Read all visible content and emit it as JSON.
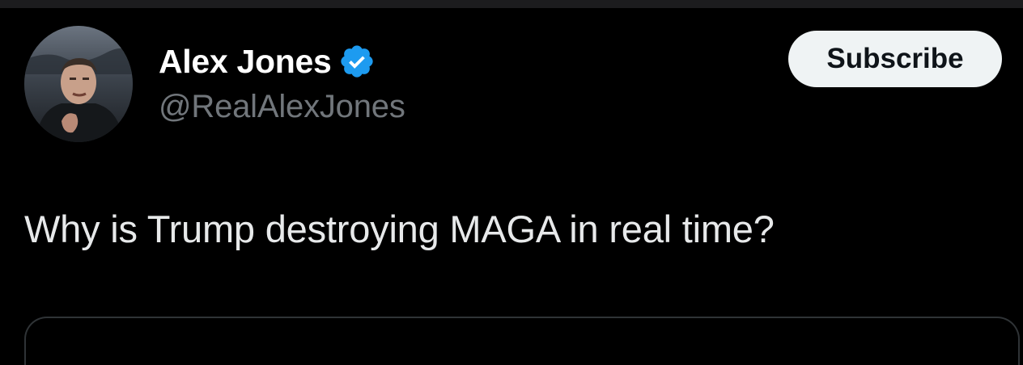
{
  "author": {
    "display_name": "Alex Jones",
    "handle": "@RealAlexJones",
    "verified": true,
    "verified_color": "#1d9bf0",
    "avatar_icon": "profile-photo"
  },
  "actions": {
    "subscribe_label": "Subscribe"
  },
  "post": {
    "text": "Why is Trump destroying MAGA in real time?"
  },
  "colors": {
    "background": "#000000",
    "text_primary": "#e7e9ea",
    "text_secondary": "#71767b",
    "button_bg": "#eff3f4",
    "button_text": "#0f1419",
    "border": "#2f3336"
  }
}
